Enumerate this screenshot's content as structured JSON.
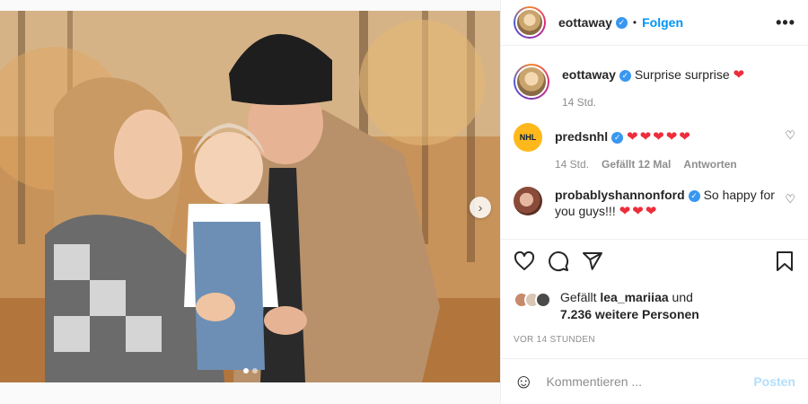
{
  "post": {
    "author": "eottaway",
    "follow_label": "Folgen",
    "more_label": "•••",
    "caption_text": "Surprise surprise",
    "caption_heart": "❤",
    "caption_time": "14 Std."
  },
  "comments": [
    {
      "user": "predsnhl",
      "text": "❤❤❤❤❤",
      "time": "14 Std.",
      "likes": "Gefällt 12 Mal",
      "reply": "Antworten"
    },
    {
      "user": "probablyshannonford",
      "text": "So happy for you guys!!! ",
      "hearts": "❤❤❤"
    }
  ],
  "likes": {
    "prefix": "Gefällt ",
    "user": "lea_mariiaa",
    "connector": " und",
    "rest": "7.236 weitere Personen"
  },
  "time_ago": "VOR 14 STUNDEN",
  "add_comment": {
    "placeholder": "Kommentieren ...",
    "post_label": "Posten"
  },
  "icons": {
    "like": "heart-outline-icon",
    "comment": "comment-icon",
    "share": "share-icon",
    "save": "bookmark-icon",
    "emoji": "emoji-icon",
    "next": "chevron-right-icon"
  },
  "colors": {
    "accent": "#0095f6",
    "verified": "#3897f0",
    "heart": "#ed2d3b",
    "muted": "#8e8e8e"
  }
}
